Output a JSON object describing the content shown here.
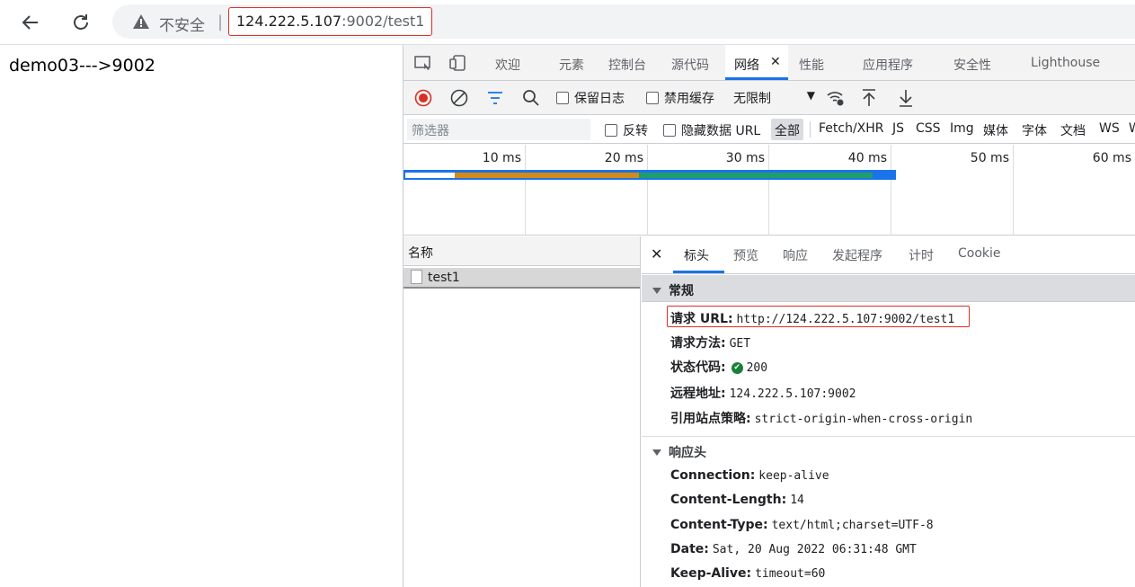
{
  "browser": {
    "insecure_label": "不安全",
    "separator": "|",
    "url_host": "124.222.5.107",
    "url_rest": ":9002/test1"
  },
  "page": {
    "text": "demo03--->9002"
  },
  "devtools": {
    "tabs": [
      "欢迎",
      "元素",
      "控制台",
      "源代码",
      "网络",
      "性能",
      "应用程序",
      "安全性",
      "Lighthouse"
    ],
    "active_tab": "网络",
    "toolbar": {
      "preserve_log": "保留日志",
      "disable_cache": "禁用缓存",
      "throttle": "无限制"
    },
    "filter": {
      "placeholder": "筛选器",
      "invert": "反转",
      "hide_data_urls": "隐藏数据 URL",
      "types": [
        "全部",
        "Fetch/XHR",
        "JS",
        "CSS",
        "Img",
        "媒体",
        "字体",
        "文档",
        "WS",
        "W"
      ]
    },
    "overview_ticks": [
      "10 ms",
      "20 ms",
      "30 ms",
      "40 ms",
      "50 ms",
      "60 ms"
    ],
    "request_list": {
      "header": "名称",
      "rows": [
        "test1"
      ]
    },
    "details": {
      "tabs": [
        "标头",
        "预览",
        "响应",
        "发起程序",
        "计时",
        "Cookie"
      ],
      "active_tab": "标头",
      "general": {
        "title": "常规",
        "rows": [
          {
            "k": "请求 URL:",
            "v": "http://124.222.5.107:9002/test1"
          },
          {
            "k": "请求方法:",
            "v": "GET"
          },
          {
            "k": "状态代码:",
            "v": "200"
          },
          {
            "k": "远程地址:",
            "v": "124.222.5.107:9002"
          },
          {
            "k": "引用站点策略:",
            "v": "strict-origin-when-cross-origin"
          }
        ]
      },
      "response": {
        "title": "响应头",
        "rows": [
          {
            "k": "Connection:",
            "v": "keep-alive"
          },
          {
            "k": "Content-Length:",
            "v": "14"
          },
          {
            "k": "Content-Type:",
            "v": "text/html;charset=UTF-8"
          },
          {
            "k": "Date:",
            "v": "Sat, 20 Aug 2022 06:31:48 GMT"
          },
          {
            "k": "Keep-Alive:",
            "v": "timeout=60"
          }
        ]
      }
    }
  },
  "colors": {
    "accent": "#1a73e8",
    "highlight_box": "#d93025",
    "status_ok": "#188038",
    "waterfall_orange": "#d48a17",
    "waterfall_green": "#1e9e6a"
  }
}
